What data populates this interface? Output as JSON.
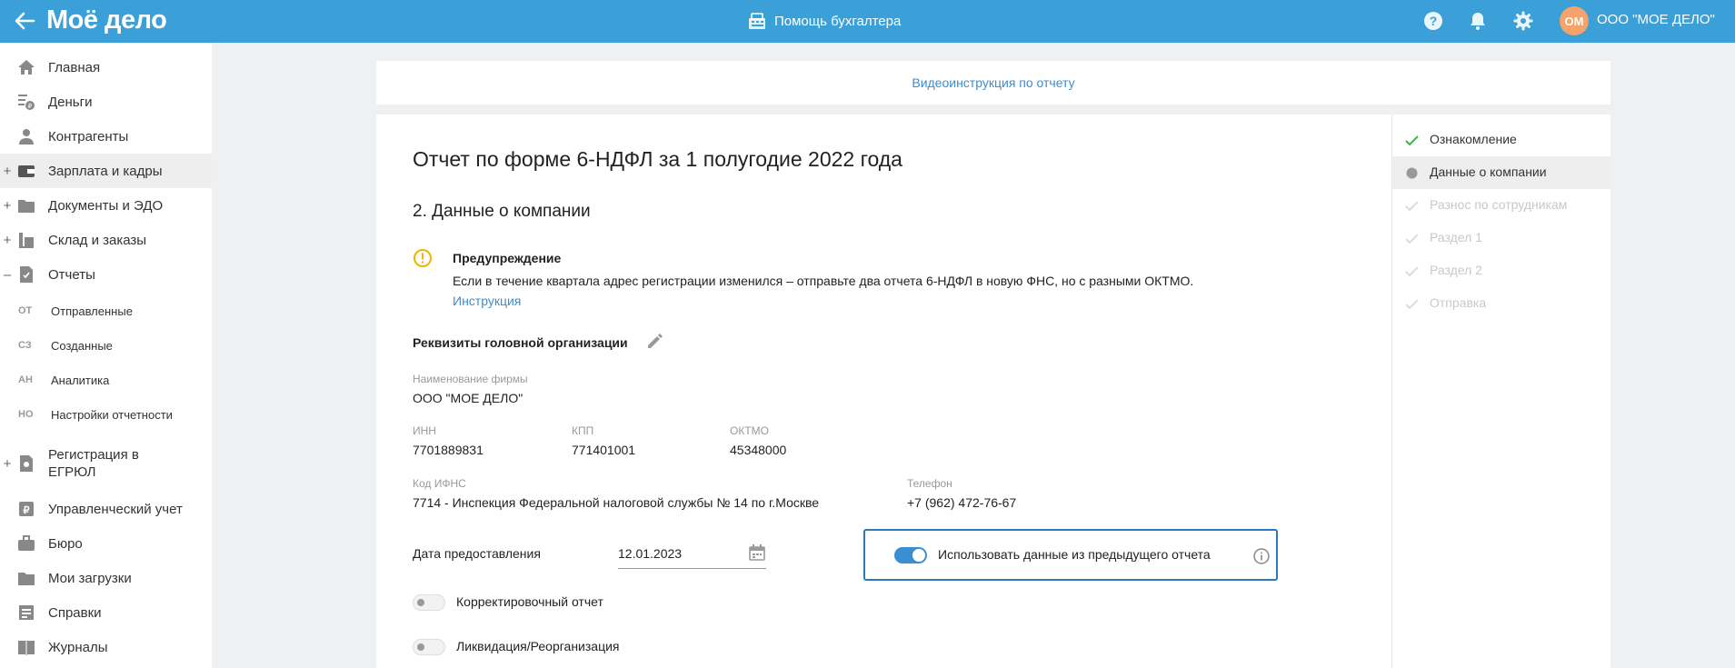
{
  "header": {
    "logo": "Моё дело",
    "helper_label": "Помощь бухгалтера",
    "avatar_initials": "ОМ",
    "org_name": "ООО \"МОЕ ДЕЛО\"",
    "colors": {
      "bar": "#3b9fd8",
      "avatar": "#f6a26a"
    }
  },
  "sidebar": {
    "items": [
      {
        "label": "Главная",
        "icon": "home-icon"
      },
      {
        "label": "Деньги",
        "icon": "money-icon"
      },
      {
        "label": "Контрагенты",
        "icon": "contractor-icon"
      },
      {
        "label": "Зарплата и кадры",
        "icon": "wallet-icon"
      },
      {
        "label": "Документы и ЭДО",
        "icon": "folder-icon"
      },
      {
        "label": "Склад и заказы",
        "icon": "warehouse-icon"
      },
      {
        "label": "Отчеты",
        "icon": "report-icon"
      },
      {
        "label": "Регистрация в ЕГРЮЛ",
        "icon": "registration-icon"
      },
      {
        "label": "Управленческий учет",
        "icon": "management-icon"
      },
      {
        "label": "Бюро",
        "icon": "briefcase-icon"
      },
      {
        "label": "Мои загрузки",
        "icon": "downloads-icon"
      },
      {
        "label": "Справки",
        "icon": "certificate-icon"
      },
      {
        "label": "Журналы",
        "icon": "journal-icon"
      }
    ],
    "expand_plus": "+",
    "expand_minus": "–",
    "reports_sub": [
      {
        "abbr": "ОТ",
        "label": "Отправленные"
      },
      {
        "abbr": "СЗ",
        "label": "Созданные"
      },
      {
        "abbr": "АН",
        "label": "Аналитика"
      },
      {
        "abbr": "НО",
        "label": "Настройки отчетности"
      }
    ]
  },
  "video_link": "Видеоинструкция по отчету",
  "report": {
    "title": "Отчет по форме 6-НДФЛ за 1 полугодие 2022 года",
    "section_title": "2. Данные о компании",
    "warning": {
      "title": "Предупреждение",
      "text": "Если в течение квартала адрес регистрации изменился – отправьте два отчета 6-НДФЛ в новую ФНС, но с разными ОКТМО.",
      "link": "Инструкция"
    },
    "requisites_title": "Реквизиты головной организации",
    "fields": {
      "firm_name_label": "Наименование фирмы",
      "firm_name": "ООО \"МОЕ ДЕЛО\"",
      "inn_label": "ИНН",
      "inn": "7701889831",
      "kpp_label": "КПП",
      "kpp": "771401001",
      "oktmo_label": "ОКТМО",
      "oktmo": "45348000",
      "ifns_label": "Код ИФНС",
      "ifns": "7714 - Инспекция Федеральной налоговой службы № 14 по г.Москве",
      "phone_label": "Телефон",
      "phone": "+7 (962) 472-76-67"
    },
    "date_label": "Дата предоставления",
    "date_value": "12.01.2023",
    "use_previous_label": "Использовать данные из предыдущего отчета",
    "use_previous_on": true,
    "corrective_label": "Корректировочный отчет",
    "liquidation_label": "Ликвидация/Реорганизация"
  },
  "steps": [
    {
      "label": "Ознакомление",
      "state": "done"
    },
    {
      "label": "Данные о компании",
      "state": "active"
    },
    {
      "label": "Разнос по сотрудникам",
      "state": "todo"
    },
    {
      "label": "Раздел 1",
      "state": "todo"
    },
    {
      "label": "Раздел 2",
      "state": "todo"
    },
    {
      "label": "Отправка",
      "state": "todo"
    }
  ]
}
